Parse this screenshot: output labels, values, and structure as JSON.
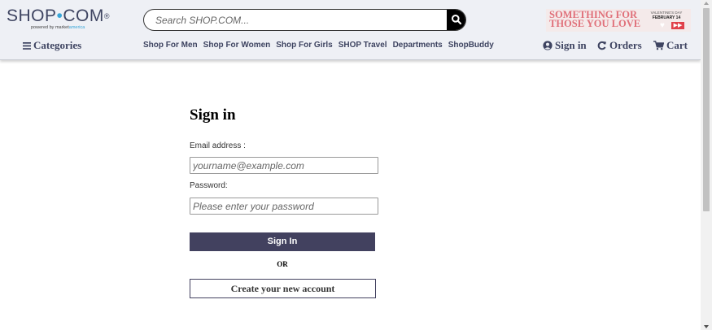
{
  "header": {
    "logo": {
      "text_left": "SHOP",
      "text_dot": "•",
      "text_right": "COM",
      "mark": "®",
      "tagline_prefix": "powered by market",
      "tagline_brand": "america"
    },
    "search": {
      "placeholder": "Search SHOP.COM...",
      "value": "",
      "icon": "search-icon"
    },
    "promo": {
      "line1": "SOMETHING FOR",
      "line2": "THOSE YOU LOVE",
      "event": "VALENTINE'S DAY",
      "date": "FEBRUARY 14",
      "play_icon": "▶▶"
    },
    "categories_label": "Categories",
    "nav": [
      "Shop For Men",
      "Shop For Women",
      "Shop For Girls",
      "SHOP Travel",
      "Departments",
      "ShopBuddy"
    ],
    "account": {
      "signin": "Sign in",
      "orders": "Orders",
      "cart": "Cart"
    }
  },
  "form": {
    "title": "Sign in",
    "email_label": "Email address :",
    "email_placeholder": "yourname@example.com",
    "email_value": "",
    "password_label": "Password:",
    "password_placeholder": "Please enter your password",
    "password_value": "",
    "signin_button": "Sign In",
    "or": "OR",
    "create_button": "Create your new account"
  },
  "colors": {
    "brand": "#3e4461",
    "accent": "#39a6d8",
    "button": "#42415f",
    "header_bg": "#eef0f5",
    "promo_text": "#e0707a"
  }
}
